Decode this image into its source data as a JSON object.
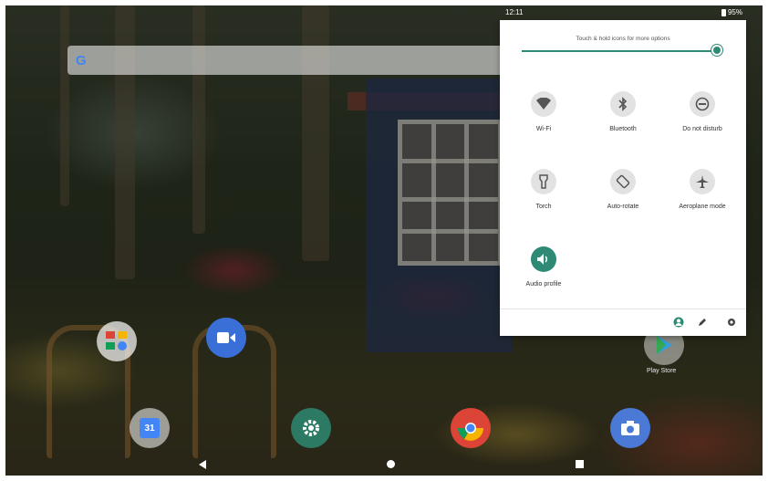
{
  "status_bar": {
    "time": "12:11",
    "battery": "95%"
  },
  "search_bar": {
    "logo": "G"
  },
  "home": {
    "apps": [
      {
        "name": "Gmail & Photos",
        "label": ""
      },
      {
        "name": "Duo",
        "label": ""
      },
      {
        "name": "Calendar",
        "label": ""
      },
      {
        "name": "Settings",
        "label": ""
      },
      {
        "name": "Chrome",
        "label": ""
      },
      {
        "name": "Camera",
        "label": ""
      },
      {
        "name": "Play Store",
        "label": "Play Store"
      }
    ],
    "calendar_day": "31"
  },
  "quick_settings": {
    "hint": "Touch & hold icons for more options",
    "brightness": 1.0,
    "accent_color": "#2e8a74",
    "tiles": [
      {
        "label": "Wi-Fi",
        "icon": "wifi-icon",
        "active": false
      },
      {
        "label": "Bluetooth",
        "icon": "bluetooth-icon",
        "active": false
      },
      {
        "label": "Do not disturb",
        "icon": "do-not-disturb-icon",
        "active": false
      },
      {
        "label": "Torch",
        "icon": "torch-icon",
        "active": false
      },
      {
        "label": "Auto-rotate",
        "icon": "auto-rotate-icon",
        "active": false
      },
      {
        "label": "Aeroplane mode",
        "icon": "airplane-icon",
        "active": false
      },
      {
        "label": "Audio profile",
        "icon": "audio-profile-icon",
        "active": true
      }
    ],
    "footer": [
      "user-icon",
      "edit-icon",
      "settings-icon"
    ]
  }
}
